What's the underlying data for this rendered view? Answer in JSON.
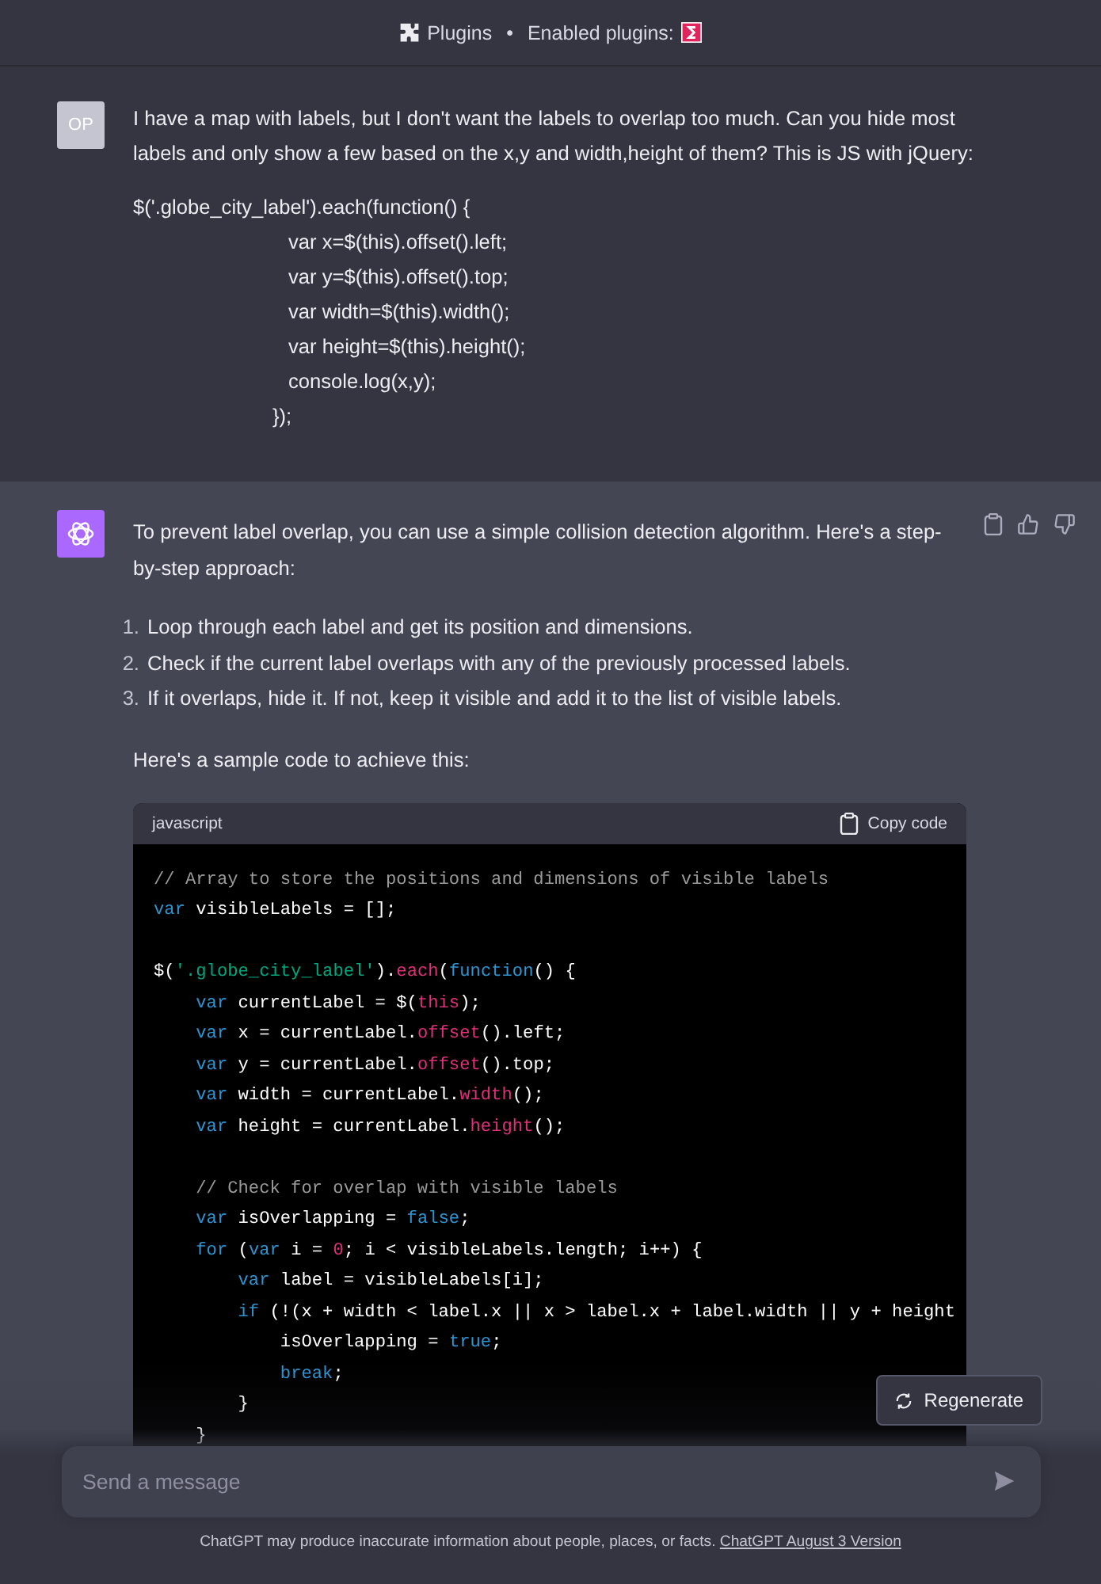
{
  "header": {
    "plugins_label": "Plugins",
    "separator": "•",
    "enabled_label": "Enabled plugins:"
  },
  "user_message": {
    "avatar": "OP",
    "paragraphs": [
      "I have a map with labels, but I don't want the labels to overlap too much. Can you hide most labels and only show a few based on the x,y and width,height of them? This is JS with jQuery:"
    ],
    "code_lines": [
      {
        "kind": "opening",
        "text": "$('.globe_city_label').each(function() {"
      },
      {
        "kind": "statement",
        "text": "var x=$(this).offset().left;"
      },
      {
        "kind": "statement",
        "text": "var y=$(this).offset().top;"
      },
      {
        "kind": "statement",
        "text": "var width=$(this).width();"
      },
      {
        "kind": "statement",
        "text": "var height=$(this).height();"
      },
      {
        "kind": "statement",
        "text": "console.log(x,y);"
      },
      {
        "kind": "closing",
        "text": "});"
      }
    ]
  },
  "assistant_message": {
    "intro": "To prevent label overlap, you can use a simple collision detection algorithm. Here's a step-by-step approach:",
    "steps": [
      {
        "marker": "1.",
        "text": "Loop through each label and get its position and dimensions."
      },
      {
        "marker": "2.",
        "text": "Check if the current label overlaps with any of the previously processed labels."
      },
      {
        "marker": "3.",
        "text": "If it overlaps, hide it. If not, keep it visible and add it to the list of visible labels."
      }
    ],
    "outro": "Here's a sample code to achieve this:",
    "code_block": {
      "language": "javascript",
      "copy_label": "Copy code",
      "blocks": [
        [
          [
            {
              "kind": "comment",
              "text": "// Array to store the positions and dimensions of visible labels"
            }
          ],
          [
            {
              "kind": "keyword",
              "text": "var"
            },
            {
              "kind": "plain",
              "text": " visibleLabels = [];"
            }
          ]
        ],
        [
          [
            {
              "kind": "plain",
              "text": "$("
            },
            {
              "kind": "string",
              "text": "'.globe_city_label'"
            },
            {
              "kind": "plain",
              "text": ")."
            },
            {
              "kind": "function",
              "text": "each"
            },
            {
              "kind": "plain",
              "text": "("
            },
            {
              "kind": "keyword",
              "text": "function"
            },
            {
              "kind": "plain",
              "text": "() {"
            }
          ],
          [
            {
              "kind": "keyword",
              "text": "    var"
            },
            {
              "kind": "plain",
              "text": " currentLabel = $("
            },
            {
              "kind": "function",
              "text": "this"
            },
            {
              "kind": "plain",
              "text": ");"
            }
          ],
          [
            {
              "kind": "keyword",
              "text": "    var"
            },
            {
              "kind": "plain",
              "text": " x = currentLabel."
            },
            {
              "kind": "function",
              "text": "offset"
            },
            {
              "kind": "plain",
              "text": "().left;"
            }
          ],
          [
            {
              "kind": "keyword",
              "text": "    var"
            },
            {
              "kind": "plain",
              "text": " y = currentLabel."
            },
            {
              "kind": "function",
              "text": "offset"
            },
            {
              "kind": "plain",
              "text": "().top;"
            }
          ],
          [
            {
              "kind": "keyword",
              "text": "    var"
            },
            {
              "kind": "plain",
              "text": " width = currentLabel."
            },
            {
              "kind": "function",
              "text": "width"
            },
            {
              "kind": "plain",
              "text": "();"
            }
          ],
          [
            {
              "kind": "keyword",
              "text": "    var"
            },
            {
              "kind": "plain",
              "text": " height = currentLabel."
            },
            {
              "kind": "function",
              "text": "height"
            },
            {
              "kind": "plain",
              "text": "();"
            }
          ]
        ],
        [
          [
            {
              "kind": "comment",
              "text": "    // Check for overlap with visible labels"
            }
          ],
          [
            {
              "kind": "keyword",
              "text": "    var"
            },
            {
              "kind": "plain",
              "text": " isOverlapping = "
            },
            {
              "kind": "keyword",
              "text": "false"
            },
            {
              "kind": "plain",
              "text": ";"
            }
          ],
          [
            {
              "kind": "keyword",
              "text": "    for"
            },
            {
              "kind": "plain",
              "text": " ("
            },
            {
              "kind": "keyword",
              "text": "var"
            },
            {
              "kind": "plain",
              "text": " i = "
            },
            {
              "kind": "number",
              "text": "0"
            },
            {
              "kind": "plain",
              "text": "; i < visibleLabels.length; i++) {"
            }
          ],
          [
            {
              "kind": "keyword",
              "text": "        var"
            },
            {
              "kind": "plain",
              "text": " label = visibleLabels[i];"
            }
          ],
          [
            {
              "kind": "keyword",
              "text": "        if"
            },
            {
              "kind": "plain",
              "text": " (!(x + width < label.x || x > label.x + label.width || y + height"
            }
          ],
          [
            {
              "kind": "plain",
              "text": "            isOverlapping = "
            },
            {
              "kind": "keyword",
              "text": "true"
            },
            {
              "kind": "plain",
              "text": ";"
            }
          ],
          [
            {
              "kind": "keyword",
              "text": "            break"
            },
            {
              "kind": "plain",
              "text": ";"
            }
          ],
          [
            {
              "kind": "plain",
              "text": "        }"
            }
          ],
          [
            {
              "kind": "plain",
              "text": "    }"
            }
          ]
        ]
      ]
    }
  },
  "regenerate_label": "Regenerate",
  "composer": {
    "placeholder": "Send a message"
  },
  "disclaimer": {
    "text": "ChatGPT may produce inaccurate information about people, places, or facts.",
    "link": "ChatGPT August 3 Version"
  }
}
